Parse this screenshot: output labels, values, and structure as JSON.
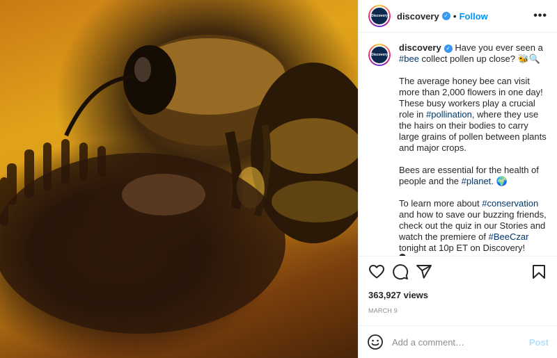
{
  "account": {
    "username": "discovery",
    "avatar_text": "Discovery",
    "follow_label": "Follow",
    "separator": "•"
  },
  "caption": {
    "username": "discovery",
    "line1_text": "Have you ever seen a ",
    "line1_tag": "#bee",
    "line1_rest": " collect pollen up close? 🐝🔍",
    "p2_a": "The average honey bee can visit more than 2,000 flowers in one day! These busy workers play a crucial role in ",
    "p2_tag": "#pollination",
    "p2_b": ", where they use the hairs on their bodies to carry large grains of pollen between plants and major crops.",
    "p3_a": "Bees are essential for the health of people and the ",
    "p3_tag": "#planet",
    "p3_b": ". 🌍",
    "p4_a": "To learn more about ",
    "p4_tag1": "#conservation",
    "p4_b": " and how to save our buzzing friends, check out the quiz in our Stories and watch the premiere of ",
    "p4_tag2": "#BeeCzar",
    "p4_c": " tonight at 10p ET on Discovery!"
  },
  "stats": {
    "views": "363,927 views",
    "date": "MARCH 9"
  },
  "comment": {
    "placeholder": "Add a comment…",
    "post_label": "Post"
  },
  "icons": {
    "more": "more-options-icon",
    "like": "heart-icon",
    "comment": "comment-icon",
    "share": "share-icon",
    "save": "bookmark-icon",
    "emoji": "emoji-icon",
    "verified": "verified-badge-icon"
  },
  "colors": {
    "link": "#0095f6",
    "hashtag": "#00376b",
    "post_disabled": "#b2dffc"
  }
}
